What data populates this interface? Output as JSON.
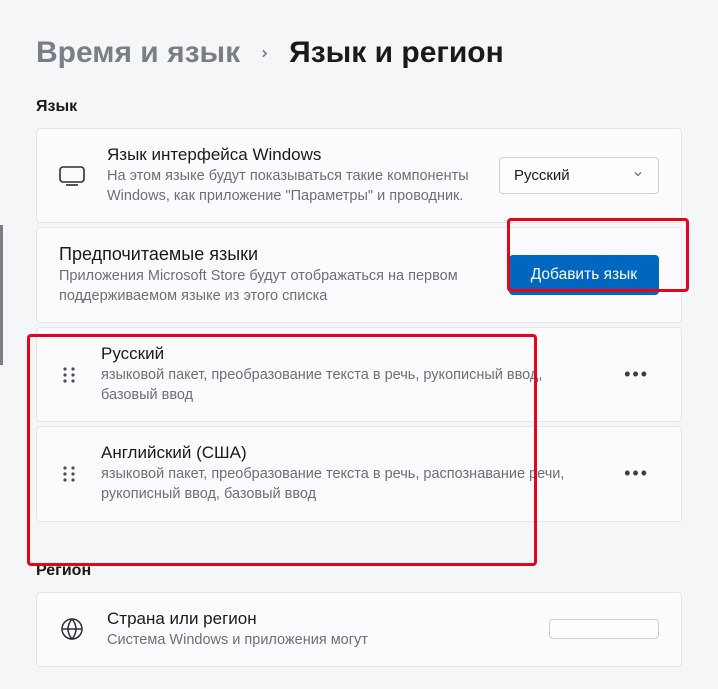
{
  "breadcrumb": {
    "parent": "Время и язык",
    "current": "Язык и регион"
  },
  "sections": {
    "language_header": "Язык",
    "region_header": "Регион"
  },
  "display_language": {
    "title": "Язык интерфейса Windows",
    "desc": "На этом языке будут показываться такие компоненты Windows, как приложение \"Параметры\" и проводник.",
    "selected": "Русский"
  },
  "preferred": {
    "title": "Предпочитаемые языки",
    "desc": "Приложения Microsoft Store будут отображаться на первом поддерживаемом языке из этого списка",
    "add_label": "Добавить язык"
  },
  "languages": [
    {
      "name": "Русский",
      "desc": "языковой пакет, преобразование текста в речь, рукописный ввод, базовый ввод"
    },
    {
      "name": "Английский (США)",
      "desc": "языковой пакет, преобразование текста в речь, распознавание речи, рукописный ввод, базовый ввод"
    }
  ],
  "country": {
    "title": "Страна или регион",
    "desc": "Система Windows и приложения могут"
  }
}
